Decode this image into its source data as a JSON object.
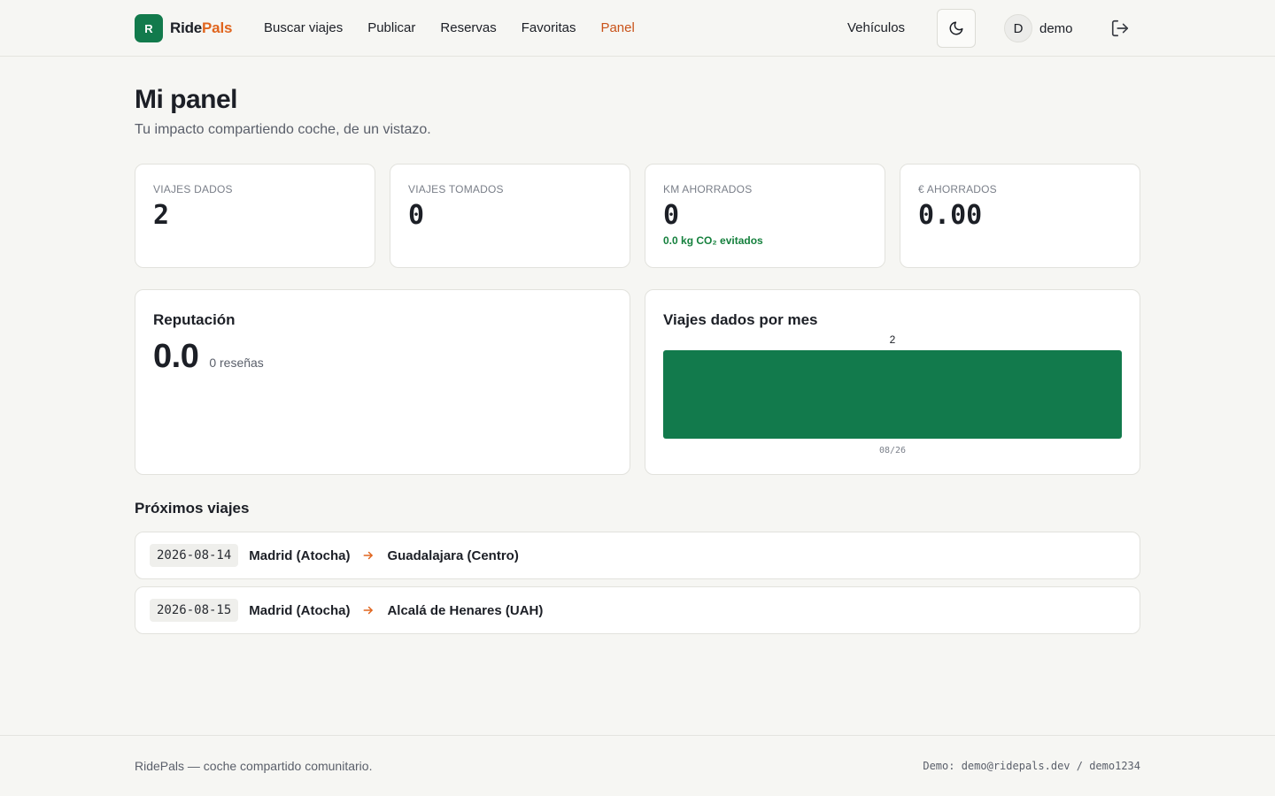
{
  "brand": {
    "logo_letter": "R",
    "name_part1": "Ride",
    "name_part2": "Pals",
    "accent_color": "#e0651e",
    "brand_color": "#127a4c"
  },
  "nav": {
    "items": [
      {
        "label": "Buscar viajes",
        "active": false
      },
      {
        "label": "Publicar",
        "active": false
      },
      {
        "label": "Reservas",
        "active": false
      },
      {
        "label": "Favoritas",
        "active": false
      },
      {
        "label": "Panel",
        "active": true
      }
    ],
    "vehicles": "Vehículos",
    "theme_icon": "moon-icon",
    "logout_icon": "logout-icon"
  },
  "user": {
    "initial": "D",
    "name": "demo"
  },
  "page": {
    "title": "Mi panel",
    "subtitle": "Tu impacto compartiendo coche, de un vistazo."
  },
  "stats": [
    {
      "label": "VIAJES DADOS",
      "value": "2",
      "note": ""
    },
    {
      "label": "VIAJES TOMADOS",
      "value": "0",
      "note": ""
    },
    {
      "label": "KM AHORRADOS",
      "value": "0",
      "note": "0.0 kg CO₂ evitados"
    },
    {
      "label": "€ AHORRADOS",
      "value": "0.00",
      "note": ""
    }
  ],
  "reputation": {
    "title": "Reputación",
    "score": "0.0",
    "reviews": "0 reseñas"
  },
  "monthly_chart": {
    "title": "Viajes dados por mes"
  },
  "chart_data": {
    "type": "bar",
    "title": "Viajes dados por mes",
    "categories": [
      "08/26"
    ],
    "values": [
      2
    ],
    "data_labels": [
      "2"
    ],
    "ylim": [
      0,
      2
    ],
    "grid": false,
    "color": "#127a4c"
  },
  "upcoming": {
    "title": "Próximos viajes",
    "trips": [
      {
        "date": "2026-08-14",
        "from": "Madrid (Atocha)",
        "to": "Guadalajara (Centro)"
      },
      {
        "date": "2026-08-15",
        "from": "Madrid (Atocha)",
        "to": "Alcalá de Henares (UAH)"
      }
    ]
  },
  "footer": {
    "left": "RidePals — coche compartido comunitario.",
    "right": "Demo: demo@ridepals.dev / demo1234"
  }
}
